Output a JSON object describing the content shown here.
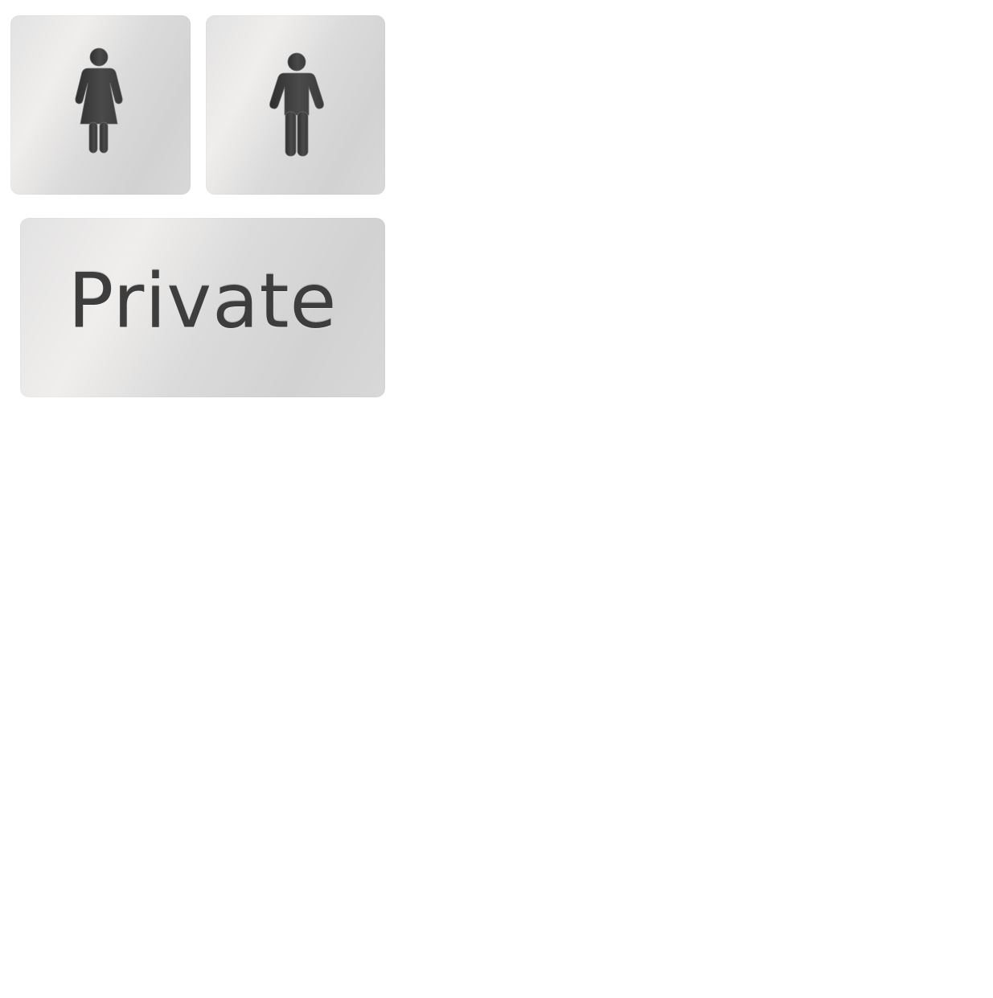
{
  "signs": {
    "female": {
      "icon": "female-figure-icon"
    },
    "male": {
      "icon": "male-figure-icon"
    },
    "private": {
      "label": "Private"
    }
  },
  "colors": {
    "plate_light": "#efeeed",
    "plate_dark": "#d2d2d2",
    "figure": "#3d3d3d",
    "background": "#ffffff"
  }
}
